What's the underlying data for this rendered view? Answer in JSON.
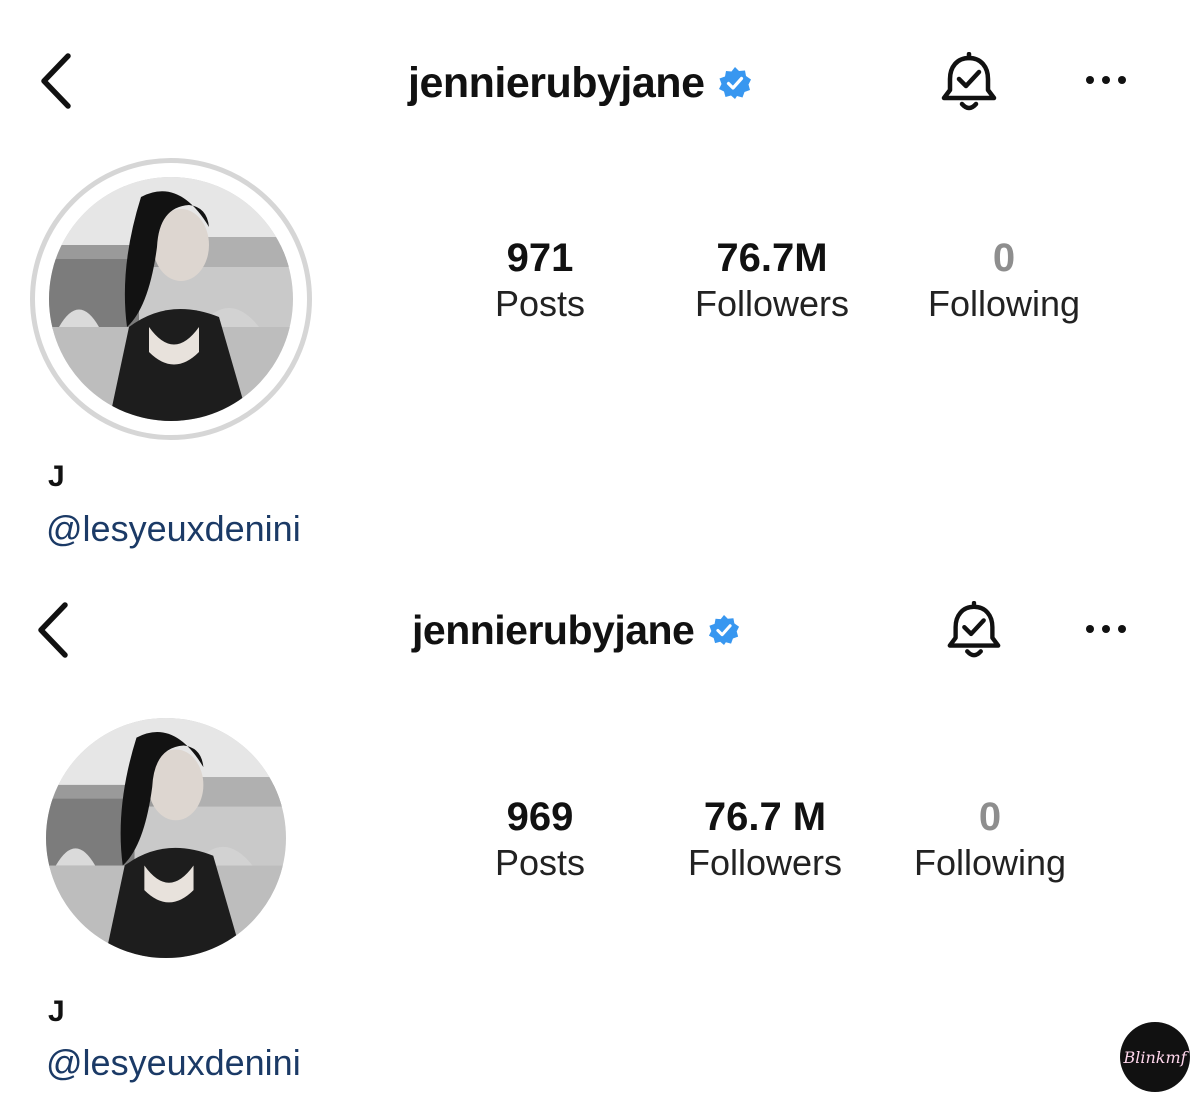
{
  "profiles": [
    {
      "username": "jennierubyjane",
      "stats": [
        {
          "value": "971",
          "label": "Posts"
        },
        {
          "value": "76.7M",
          "label": "Followers"
        },
        {
          "value": "0",
          "label": "Following"
        }
      ],
      "display_name": "J",
      "handle": "@lesyeuxdenini"
    },
    {
      "username": "jennierubyjane",
      "stats": [
        {
          "value": "969",
          "label": "Posts"
        },
        {
          "value": "76.7 M",
          "label": "Followers"
        },
        {
          "value": "0",
          "label": "Following"
        }
      ],
      "display_name": "J",
      "handle": "@lesyeuxdenini"
    }
  ],
  "watermark": "Blinkmf",
  "colors": {
    "verified_badge": "#3897f0",
    "handle_link": "#1b3a66",
    "zero_count": "#8e8e8e"
  },
  "icons": [
    "back-arrow-icon",
    "verified-badge-icon",
    "notification-bell-check-icon",
    "more-options-icon"
  ]
}
